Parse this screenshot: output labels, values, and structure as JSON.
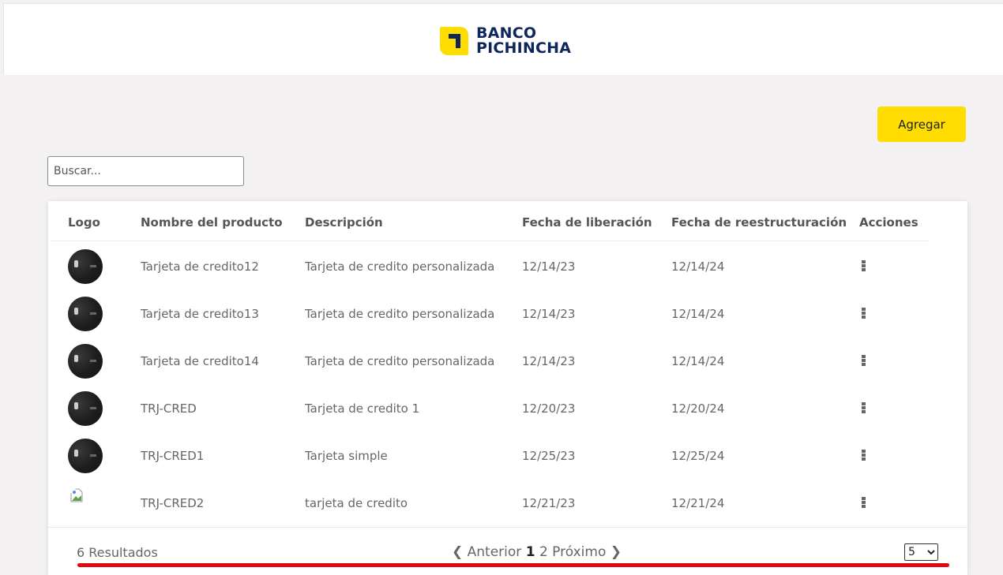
{
  "brand": {
    "line1": "BANCO",
    "line2": "PICHINCHA",
    "accent_color": "#ffdd00",
    "text_color": "#0f265c"
  },
  "toolbar": {
    "add_label": "Agregar"
  },
  "search": {
    "placeholder": "Buscar...",
    "value": ""
  },
  "table": {
    "headers": {
      "logo": "Logo",
      "name": "Nombre del producto",
      "description": "Descripción",
      "release": "Fecha de liberación",
      "restructure": "Fecha de reestructuración",
      "actions": "Acciones"
    },
    "rows": [
      {
        "logo": "card-image",
        "name": "Tarjeta de credito12",
        "description": "Tarjeta de credito personalizada",
        "release": "12/14/23",
        "restructure": "12/14/24"
      },
      {
        "logo": "card-image",
        "name": "Tarjeta de credito13",
        "description": "Tarjeta de credito personalizada",
        "release": "12/14/23",
        "restructure": "12/14/24"
      },
      {
        "logo": "card-image",
        "name": "Tarjeta de credito14",
        "description": "Tarjeta de credito personalizada",
        "release": "12/14/23",
        "restructure": "12/14/24"
      },
      {
        "logo": "card-image",
        "name": "TRJ-CRED",
        "description": "Tarjeta de credito 1",
        "release": "12/20/23",
        "restructure": "12/20/24"
      },
      {
        "logo": "card-image",
        "name": "TRJ-CRED1",
        "description": "Tarjeta simple",
        "release": "12/25/23",
        "restructure": "12/25/24"
      },
      {
        "logo": "broken-image-icon",
        "name": "TRJ-CRED2",
        "description": "tarjeta de credito",
        "release": "12/21/23",
        "restructure": "12/21/24"
      }
    ]
  },
  "footer": {
    "results": "6 Resultados",
    "prev": "❮ Anterior",
    "pages": [
      "1",
      "2"
    ],
    "current_page": "1",
    "next": "Próximo ❯",
    "page_size": "5",
    "page_size_options": [
      "5"
    ]
  },
  "icons": {
    "actions": "kebab-menu-icon"
  },
  "colors": {
    "page_bg": "#f3f1f1",
    "button": "#ffdd00",
    "annotation": "#e30613"
  }
}
